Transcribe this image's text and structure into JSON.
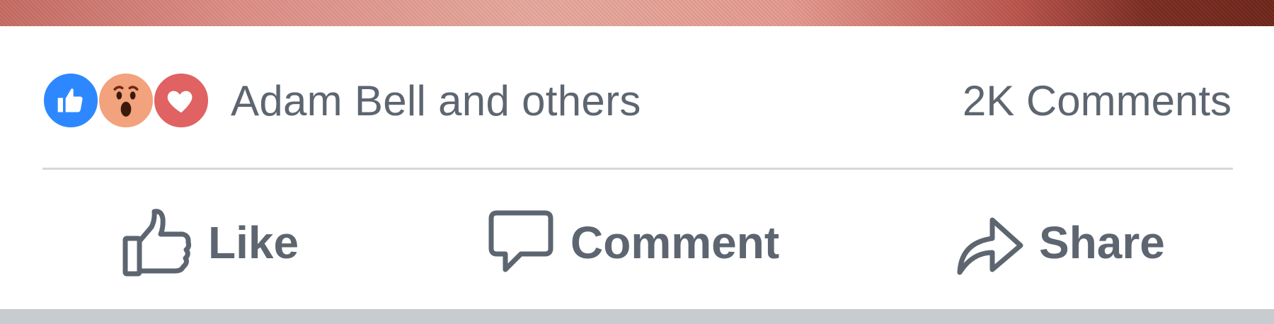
{
  "post": {
    "reactions": {
      "icons": [
        "like-icon",
        "wow-icon",
        "love-icon"
      ],
      "summary": "Adam Bell and others"
    },
    "comments_count": "2K Comments"
  },
  "actions": {
    "like_label": "Like",
    "comment_label": "Comment",
    "share_label": "Share"
  },
  "colors": {
    "like_blue": "#2d88ff",
    "wow_orange": "#f2a27c",
    "love_red": "#e06262",
    "text_gray": "#5d6670",
    "divider": "#d5d7da",
    "bottom_bar": "#c8cbcf"
  }
}
